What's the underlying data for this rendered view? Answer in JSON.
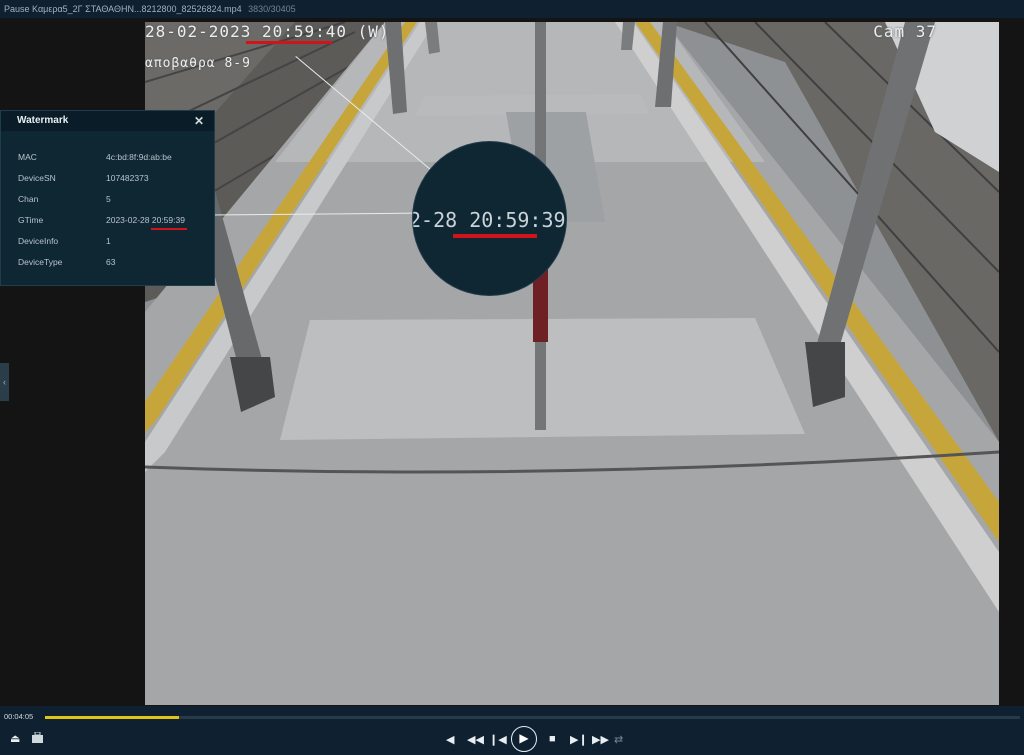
{
  "titlebar": {
    "state": "Pause",
    "filename": "Καμερα5_2Γ ΣΤΑΘΑΘΗΝ...8212800_82526824.mp4",
    "frames": "3830/30405"
  },
  "video": {
    "osd_timestamp": "28-02-2023 20:59:40 (W)",
    "osd_camera": "Cam 37",
    "osd_platform": "αποβαθρα 8-9",
    "magnifier_text": "2-28 20:59:39"
  },
  "watermark_panel": {
    "title": "Watermark",
    "close": "✕",
    "rows": [
      {
        "key": "MAC",
        "value": "4c:bd:8f:9d:ab:be"
      },
      {
        "key": "DeviceSN",
        "value": "107482373"
      },
      {
        "key": "Chan",
        "value": "5"
      },
      {
        "key": "GTime",
        "value": "2023-02-28 20:59:39"
      },
      {
        "key": "DeviceInfo",
        "value": "1"
      },
      {
        "key": "DeviceType",
        "value": "63"
      }
    ]
  },
  "playback": {
    "time": "00:04:05",
    "progress_fraction": 0.137,
    "accent_color": "#e0c516",
    "icons": [
      "eject-icon",
      "toolbox-icon",
      "prev-frame-icon",
      "rewind-icon",
      "step-back-icon",
      "play-icon",
      "stop-icon",
      "step-forward-icon",
      "fast-forward-icon",
      "speed-icon"
    ]
  }
}
